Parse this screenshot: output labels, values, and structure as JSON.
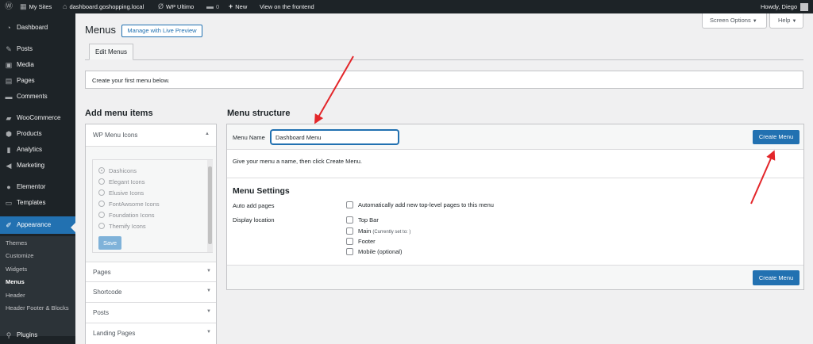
{
  "admin_bar": {
    "my_sites": "My Sites",
    "site_name": "dashboard.goshopping.local",
    "wp_ultimo": "WP Ultimo",
    "comments_count": "0",
    "new_label": "New",
    "view_frontend": "View on the frontend",
    "howdy": "Howdy, Diego"
  },
  "sidebar": {
    "items": [
      {
        "label": "Dashboard",
        "icon": "dashboard-icon"
      },
      {
        "label": "Posts",
        "icon": "pin-icon"
      },
      {
        "label": "Media",
        "icon": "media-icon"
      },
      {
        "label": "Pages",
        "icon": "page-icon"
      },
      {
        "label": "Comments",
        "icon": "comment-icon"
      },
      {
        "label": "WooCommerce",
        "icon": "woo-icon"
      },
      {
        "label": "Products",
        "icon": "products-icon"
      },
      {
        "label": "Analytics",
        "icon": "chart-icon"
      },
      {
        "label": "Marketing",
        "icon": "megaphone-icon"
      },
      {
        "label": "Elementor",
        "icon": "elementor-icon"
      },
      {
        "label": "Templates",
        "icon": "folder-icon"
      },
      {
        "label": "Appearance",
        "icon": "brush-icon"
      },
      {
        "label": "Plugins",
        "icon": "plugin-icon"
      }
    ],
    "submenu": [
      "Themes",
      "Customize",
      "Widgets",
      "Menus",
      "Header",
      "Header Footer & Blocks"
    ]
  },
  "header": {
    "title": "Menus",
    "live_preview_button": "Manage with Live Preview",
    "screen_options": "Screen Options",
    "help": "Help",
    "tab_edit_menus": "Edit Menus"
  },
  "notice": "Create your first menu below.",
  "add_menu_items": {
    "heading": "Add menu items",
    "icons_section": "WP Menu Icons",
    "icon_sets": [
      "Dashicons",
      "Elegant Icons",
      "Elusive Icons",
      "FontAwsome Icons",
      "Foundation Icons",
      "Themify Icons"
    ],
    "save_button": "Save",
    "sections": [
      "Pages",
      "Shortcode",
      "Posts",
      "Landing Pages"
    ]
  },
  "menu_structure": {
    "heading": "Menu structure",
    "menu_name_label": "Menu Name",
    "menu_name_value": "Dashboard Menu",
    "create_menu_button": "Create Menu",
    "instruction": "Give your menu a name, then click Create Menu.",
    "settings_heading": "Menu Settings",
    "auto_add_label": "Auto add pages",
    "auto_add_option": "Automatically add new top-level pages to this menu",
    "display_location_label": "Display location",
    "locations": [
      "Top Bar",
      "Main",
      "Footer",
      "Mobile (optional)"
    ],
    "main_note": "(Currently set to: )"
  },
  "colors": {
    "primary": "#2271b1",
    "admin_dark": "#1d2327",
    "annotation_arrow": "#e3262a"
  }
}
